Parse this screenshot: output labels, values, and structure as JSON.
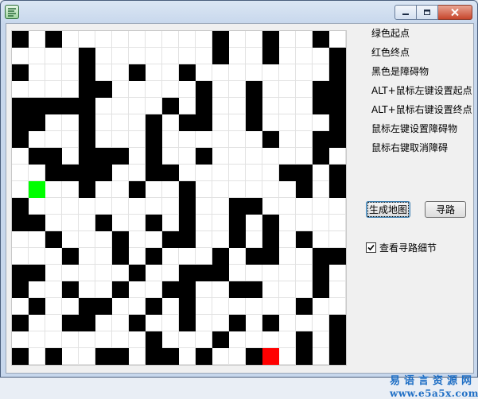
{
  "window": {
    "title": ""
  },
  "legend": [
    "绿色起点",
    "红色终点",
    "黑色是障碍物",
    "ALT+鼠标左键设置起点",
    "ALT+鼠标右键设置终点",
    "鼠标左键设置障碍物",
    "鼠标右键取消障碍"
  ],
  "buttons": {
    "generate_map": "生成地图",
    "find_path": "寻路"
  },
  "checkbox": {
    "label": "查看寻路细节",
    "checked": true
  },
  "watermark": {
    "line1": "易语言资源网",
    "line2": "www.e5a5x.com"
  },
  "colors": {
    "wall": "#000000",
    "start": "#00ff00",
    "end": "#ff0000"
  },
  "map": {
    "legend_codes": {
      ".": "empty",
      "#": "wall",
      "S": "start",
      "E": "end"
    },
    "rows": [
      "#.#.........#..#..#.",
      "....#.......#..#...#",
      "#...#..#..#........#",
      "....##.....#..#...##",
      "#####....#.#..#...##",
      "##..#...#.##..#....#",
      "#...#...#......#..##",
      ".##.###.#..#......#.",
      "..####..##......##.#",
      ".S..#..#..#......#.#",
      "#.........#..##.....",
      "##...#..#.#..#.#....",
      "..#...#..##..#.#.#..",
      "...#..#.#...#.##..##",
      "##.....#..###.....#.",
      "#..#..#..##..##...#.",
      ".#..##..#.#......#..",
      "#..##..#..#..#.#...#",
      "........#...#....#.#",
      "#.#..##.##.#..#E.#.#"
    ]
  }
}
